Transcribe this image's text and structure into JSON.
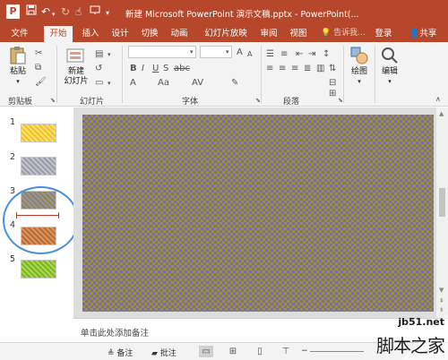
{
  "title_bar": {
    "title": "新建 Microsoft PowerPoint 演示文稿.pptx - PowerPoint(...",
    "app_icon_letter": "P",
    "icons": [
      "save-icon",
      "undo-icon",
      "redo-icon",
      "touch-mode-icon",
      "start-from-beginning-icon",
      "customize-qat-icon"
    ]
  },
  "tabs": [
    {
      "label": "文件",
      "active": false
    },
    {
      "label": "开始",
      "active": true
    },
    {
      "label": "插入",
      "active": false
    },
    {
      "label": "设计",
      "active": false
    },
    {
      "label": "切换",
      "active": false
    },
    {
      "label": "动画",
      "active": false
    },
    {
      "label": "幻灯片放映",
      "active": false
    },
    {
      "label": "审阅",
      "active": false
    },
    {
      "label": "视图",
      "active": false
    }
  ],
  "tell_me": "告诉我...",
  "account": {
    "login": "登录",
    "share": "共享"
  },
  "ribbon": {
    "paste_label": "粘贴",
    "new_slide_label_line1": "新建",
    "new_slide_label_line2": "幻灯片",
    "drawing_label": "绘图",
    "editing_label": "编辑",
    "groups": {
      "clipboard": "剪贴板",
      "slides": "幻灯片",
      "font": "字体",
      "paragraph": "段落"
    }
  },
  "thumbnails": [
    {
      "number": "1",
      "color": "#f2c12e",
      "pattern": "#fde06a"
    },
    {
      "number": "2",
      "color": "#9c9ca6",
      "pattern": "#c2c2cc"
    },
    {
      "number": "3",
      "color": "#8a8a4a",
      "pattern": "#9b8fb0"
    },
    {
      "number": "4",
      "color": "#b86a3a",
      "pattern": "#d9955a"
    },
    {
      "number": "5",
      "color": "#7db52a",
      "pattern": "#a8d84a"
    }
  ],
  "slide_colors": {
    "a": "#9a9236",
    "b": "#7c6e94"
  },
  "notes_placeholder": "单击此处添加备注",
  "status": {
    "notes_label": "备注",
    "comments_label": "批注"
  },
  "watermark": {
    "url": "jb51.net",
    "name": "脚本之家"
  },
  "colors": {
    "accent": "#b7472a",
    "annotation_circle": "#4a90d9",
    "insert_marker": "#c0392b"
  }
}
